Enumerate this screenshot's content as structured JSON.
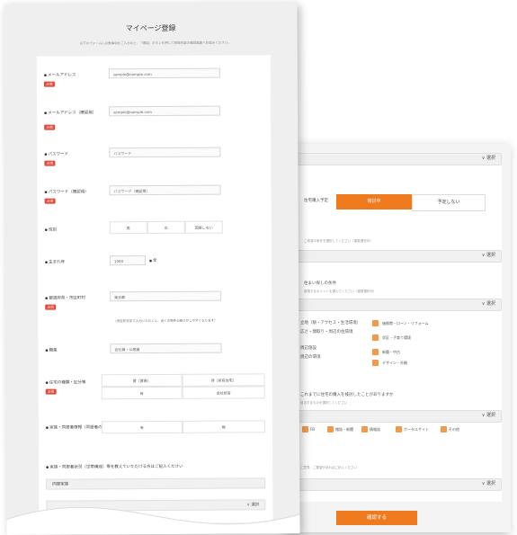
{
  "front": {
    "title": "マイページ登録",
    "description": "以下のフォームに必要事項をご入力の上、「確認」ボタンを押して登録内容の確認画面へお進みください。",
    "required_tag": "必須",
    "fields": [
      {
        "label": "メールアドレス",
        "value": "sample@sample.com"
      },
      {
        "label": "メールアドレス（確認用）",
        "value": "sample@sample.com"
      },
      {
        "label": "パスワード",
        "value": "パスワード"
      },
      {
        "label": "パスワード（確認用）",
        "value": "パスワード（確認用）"
      },
      {
        "label": "性別",
        "options": [
          "男",
          "女",
          "回答しない"
        ]
      },
      {
        "label": "生まれ年",
        "value": "1990",
        "unit": "年"
      },
      {
        "label": "都道府県・市区町村",
        "value": "東京都",
        "note": "（市区町村まで入力いただくと、近くの物件の紹介がしやすくなります）"
      },
      {
        "label": "職業",
        "value": "会社員・公務員"
      },
      {
        "label": "住宅の種類・区分等",
        "options": [
          "賃（賃貸）",
          "持（所有住宅）",
          "有",
          "会社所有"
        ]
      },
      {
        "label": "家族・同居者情報（同居者の人数、子供の年齢など）",
        "options": [
          "有",
          "無"
        ]
      }
    ],
    "bottom_question": "家族・同居者状況（世帯構成）等を教えていただける方はご記入ください",
    "bottom_bar_label": "同居家族",
    "bottom_bar_cap": "∨ 選択"
  },
  "back": {
    "top_bar_cap": "∨ 選択",
    "segment_label": "住宅購入予定",
    "segment_selected": "検討中",
    "segment_other": "予定しない",
    "hint_1": "ご希望の条件を選択してください（複数選択可）",
    "bar_2_cap": "∨ 選択",
    "section_label": "住まい探しの条件",
    "section_sub": "重視するポイントを選んでください（複数選択可）",
    "bar_3_cap": "∨ 選択",
    "check_rows": [
      {
        "left": "立地（駅・アクセス・生活環境）",
        "right": "価格帯・ローン・リフォーム"
      },
      {
        "left": "広さ・間取り・周辺の住環境",
        "right": "学区・子育て環境"
      },
      {
        "left": "周辺施設",
        "right": "新築・中古"
      },
      {
        "left": "",
        "right": "デザイン・外観"
      }
    ],
    "check_left_extra": "周辺の環境",
    "section2_label": "これまでに住宅の購入を検討したことがありますか",
    "section2_sub": "該当するものを選択してください",
    "bar_4_cap": "∨ 選択",
    "inline_checks": [
      "FB",
      "雑誌・新聞",
      "情報誌",
      "ポータルサイト",
      "その他"
    ],
    "hint_2": "ご意見・ご要望があればご記入ください",
    "bar_5_cap": "∨ 選択",
    "submit_label": "確認する"
  }
}
